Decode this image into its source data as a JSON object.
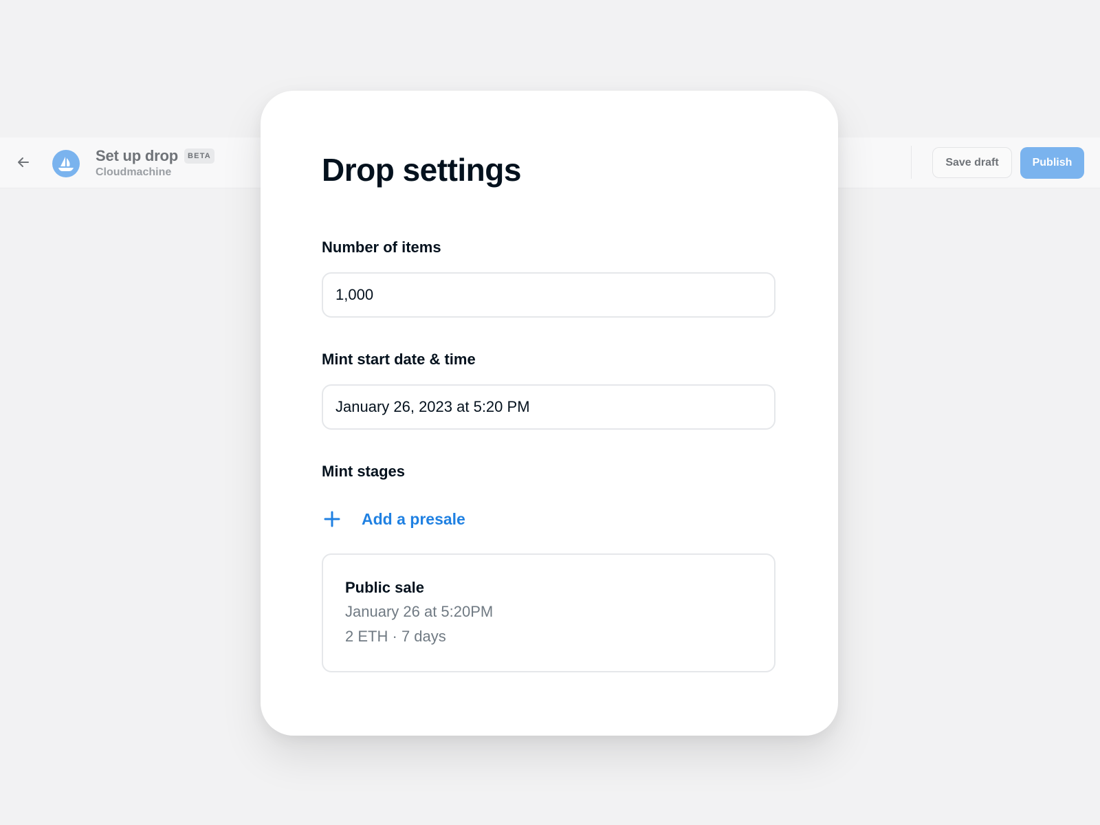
{
  "topbar": {
    "title": "Set up drop",
    "badge": "BETA",
    "subtitle": "Cloudmachine",
    "back_icon": "arrow-left-icon",
    "logo_icon": "sailboat-logo-icon",
    "save_draft_label": "Save draft",
    "publish_label": "Publish"
  },
  "modal": {
    "title": "Drop settings",
    "fields": {
      "items": {
        "label": "Number of items",
        "value": "1,000"
      },
      "start": {
        "label": "Mint start date & time",
        "value": "January 26, 2023 at 5:20 PM"
      }
    },
    "stages": {
      "label": "Mint stages",
      "add_presale_label": "Add a presale",
      "add_icon": "plus-icon",
      "public_sale": {
        "title": "Public sale",
        "date": "January 26 at 5:20PM",
        "price": "2 ETH",
        "separator": "·",
        "duration": "7 days"
      }
    }
  },
  "colors": {
    "background": "#f2f2f3",
    "accent": "#2081e2",
    "publish_button": "#7ab3ee",
    "text_primary": "#04111d",
    "text_secondary": "#707a83"
  }
}
